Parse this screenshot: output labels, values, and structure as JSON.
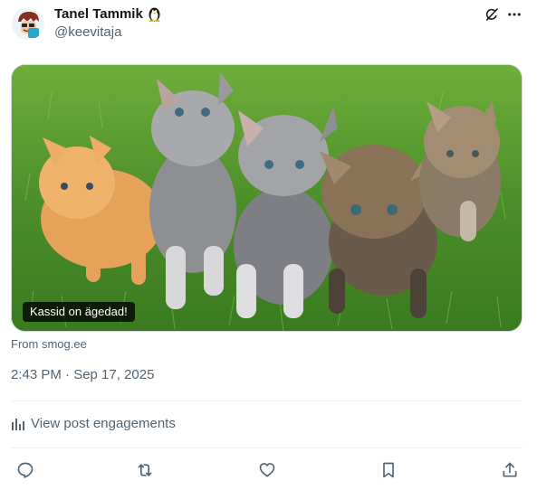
{
  "author": {
    "display_name": "Tanel Tammik",
    "badge_icon": "penguin-icon",
    "handle": "@keevitaja",
    "avatar_icon": "cartoon-avatar-icon"
  },
  "header_actions": {
    "grok_icon": "grok-icon",
    "more_icon": "more-icon"
  },
  "media": {
    "alt_caption": "Kassid on ägedad!",
    "subject": "kittens-photo"
  },
  "source": "From smog.ee",
  "timestamp": "2:43 PM · Sep 17, 2025",
  "engagements": {
    "label": "View post engagements",
    "icon": "analytics-icon"
  },
  "actions": [
    "reply-icon",
    "repost-icon",
    "like-icon",
    "bookmark-icon",
    "share-icon"
  ],
  "colors": {
    "text": "#0f1419",
    "secondary": "#536471",
    "divider": "#eff3f4"
  }
}
